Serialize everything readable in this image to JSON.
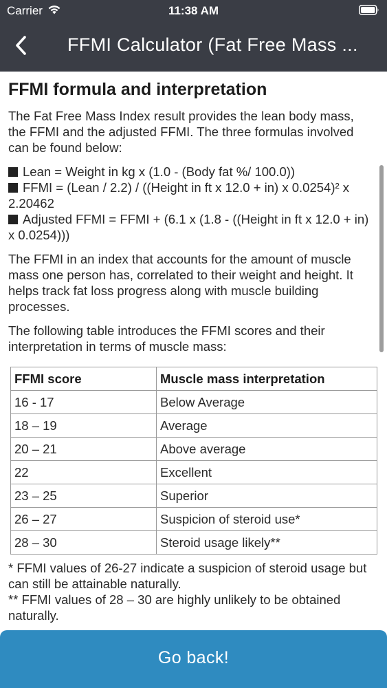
{
  "status_bar": {
    "carrier": "Carrier",
    "time": "11:38 AM",
    "wifi_icon": "wifi-icon",
    "battery_icon": "battery-icon"
  },
  "nav": {
    "back_icon": "chevron-left-icon",
    "title": "FFMI Calculator (Fat Free Mass ..."
  },
  "content": {
    "section_title": "FFMI formula and interpretation",
    "intro": "The Fat Free Mass Index result provides the lean body mass, the FFMI and the adjusted FFMI. The three formulas involved can be found below:",
    "formulas": [
      "Lean = Weight in kg x (1.0 - (Body fat %/ 100.0))",
      "FFMI = (Lean / 2.2) / ((Height in ft x 12.0 + in) x 0.0254)² x 2.20462",
      "Adjusted FFMI = FFMI + (6.1 x (1.8 - ((Height in ft x 12.0 + in) x 0.0254)))"
    ],
    "explanation": "The FFMI in an index that accounts for the amount of muscle mass one person has, correlated to their weight and height. It helps track fat loss progress along with muscle building processes.",
    "table_intro": "The following table introduces the FFMI scores and their interpretation in terms of muscle mass:",
    "table": {
      "headers": [
        "FFMI score",
        "Muscle mass interpretation"
      ],
      "rows": [
        [
          "16 - 17",
          "Below Average"
        ],
        [
          "18 – 19",
          "Average"
        ],
        [
          "20 – 21",
          "Above average"
        ],
        [
          "22",
          "Excellent"
        ],
        [
          "23 – 25",
          "Superior"
        ],
        [
          "26 – 27",
          "Suspicion of steroid use*"
        ],
        [
          "28 – 30",
          "Steroid usage likely**"
        ]
      ]
    },
    "footnote_1": "* FFMI values of 26-27 indicate a suspicion of steroid usage but can still be attainable naturally.",
    "footnote_2": "** FFMI values of 28 – 30 are highly unlikely to be obtained naturally."
  },
  "bottom_button": {
    "label": "Go back!"
  },
  "colors": {
    "header_bg": "#3a3d45",
    "button_bg": "#2f8bc0",
    "text": "#2a2a2a"
  }
}
